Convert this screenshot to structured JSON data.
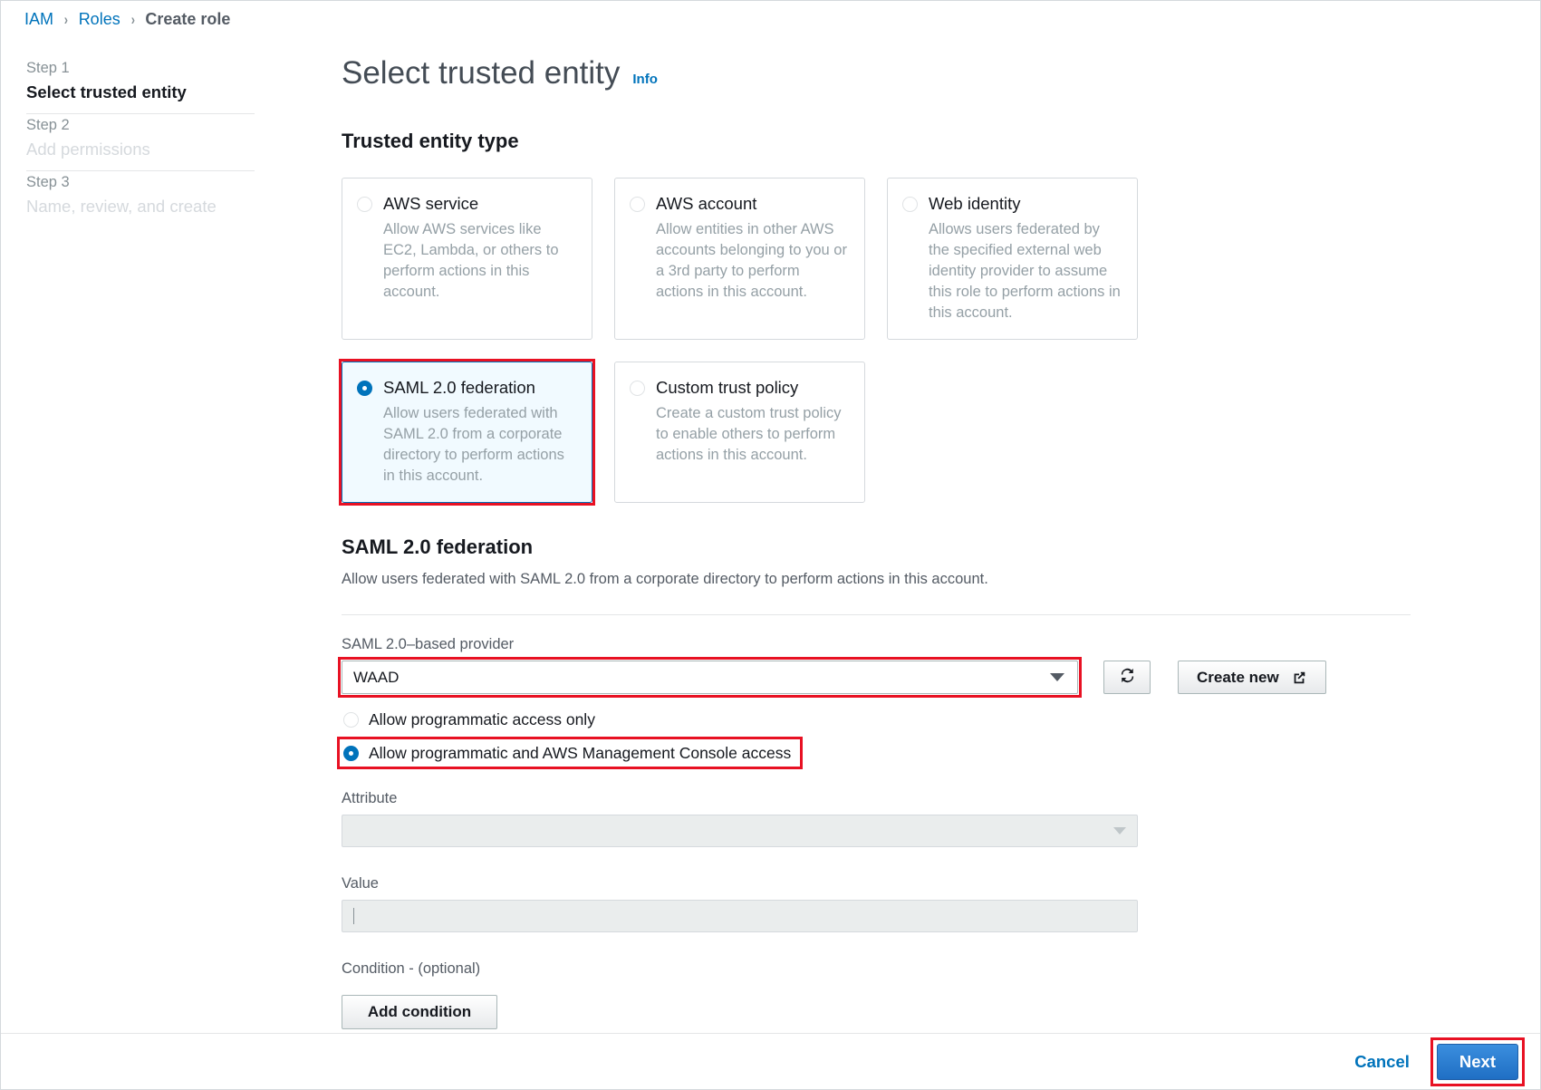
{
  "breadcrumb": {
    "items": [
      {
        "label": "IAM",
        "current": false
      },
      {
        "label": "Roles",
        "current": false
      },
      {
        "label": "Create role",
        "current": true
      }
    ],
    "separator": "›"
  },
  "steps": [
    {
      "number": "Step 1",
      "title": "Select trusted entity",
      "state": "active"
    },
    {
      "number": "Step 2",
      "title": "Add permissions",
      "state": "inactive"
    },
    {
      "number": "Step 3",
      "title": "Name, review, and create",
      "state": "inactive"
    }
  ],
  "header": {
    "title": "Select trusted entity",
    "info_label": "Info"
  },
  "trusted_entity": {
    "heading": "Trusted entity type",
    "options": [
      {
        "label": "AWS service",
        "description": "Allow AWS services like EC2, Lambda, or others to perform actions in this account.",
        "selected": false,
        "highlighted": false
      },
      {
        "label": "AWS account",
        "description": "Allow entities in other AWS accounts belonging to you or a 3rd party to perform actions in this account.",
        "selected": false,
        "highlighted": false
      },
      {
        "label": "Web identity",
        "description": "Allows users federated by the specified external web identity provider to assume this role to perform actions in this account.",
        "selected": false,
        "highlighted": false
      },
      {
        "label": "SAML 2.0 federation",
        "description": "Allow users federated with SAML 2.0 from a corporate directory to perform actions in this account.",
        "selected": true,
        "highlighted": true
      },
      {
        "label": "Custom trust policy",
        "description": "Create a custom trust policy to enable others to perform actions in this account.",
        "selected": false,
        "highlighted": false
      }
    ]
  },
  "saml_section": {
    "heading": "SAML 2.0 federation",
    "description": "Allow users federated with SAML 2.0 from a corporate directory to perform actions in this account.",
    "provider_label": "SAML 2.0–based provider",
    "provider_value": "WAAD",
    "refresh_icon": "refresh-icon",
    "create_new_label": "Create new",
    "create_new_icon": "external-link-icon",
    "access_options": [
      {
        "label": "Allow programmatic access only",
        "selected": false,
        "highlighted": false
      },
      {
        "label": "Allow programmatic and AWS Management Console access",
        "selected": true,
        "highlighted": true
      }
    ],
    "attribute_label": "Attribute",
    "attribute_value": "",
    "value_label": "Value",
    "value_value": "",
    "condition_label": "Condition - (optional)",
    "add_condition_label": "Add condition"
  },
  "footer": {
    "cancel_label": "Cancel",
    "next_label": "Next"
  },
  "colors": {
    "link": "#0073bb",
    "annotation": "#e81123",
    "selected_tile_bg": "#f1faff",
    "primary_button": "#1f6fc4"
  }
}
